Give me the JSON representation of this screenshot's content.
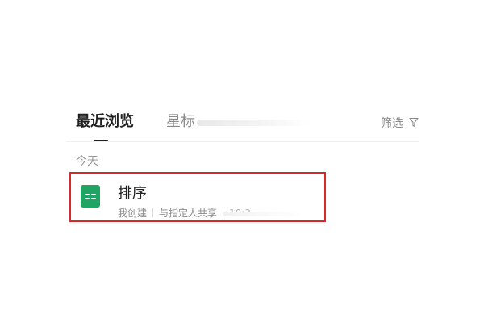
{
  "tabs": {
    "recent_label": "最近浏览",
    "starred_label": "星标"
  },
  "filter": {
    "label": "筛选",
    "icon": "filter-icon"
  },
  "section": {
    "today_label": "今天"
  },
  "file": {
    "title": "排序",
    "icon": "spreadsheet-icon",
    "icon_color": "#1fa463",
    "owner_label": "我创建",
    "share_label": "与指定人共享",
    "time": "10:3"
  },
  "highlight_color": "#d42a2a"
}
